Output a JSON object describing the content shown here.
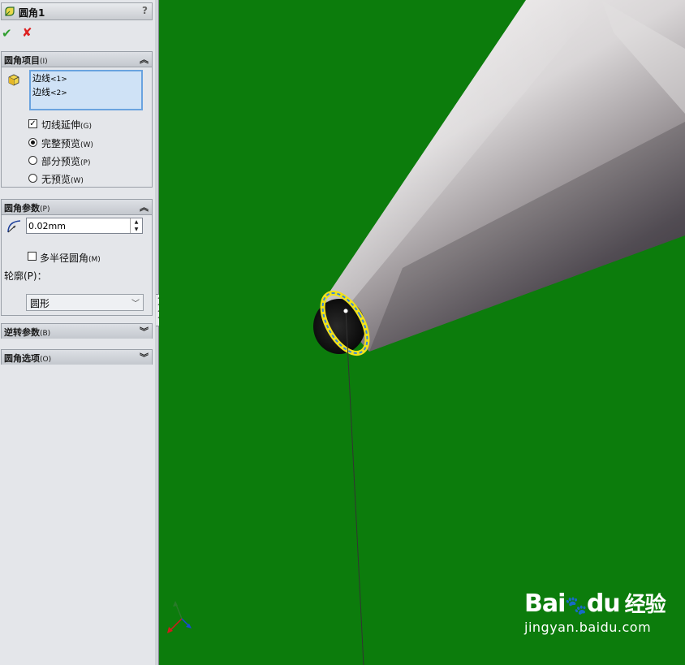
{
  "feature": {
    "title": "圆角1",
    "help": "?"
  },
  "actions": {
    "ok": "✔",
    "cancel": "✘"
  },
  "items_section": {
    "title": "圆角项目",
    "shortcut": "(I)",
    "edges": [
      {
        "name": "边线",
        "suffix": "<1>"
      },
      {
        "name": "边线",
        "suffix": "<2>"
      }
    ],
    "tangent": {
      "label": "切线延伸",
      "shortcut": "(G)",
      "checked": true
    },
    "preview_options": [
      {
        "label": "完整预览",
        "shortcut": "(W)",
        "selected": true
      },
      {
        "label": "部分预览",
        "shortcut": "(P)",
        "selected": false
      },
      {
        "label": "无预览",
        "shortcut": "(W)",
        "selected": false
      }
    ]
  },
  "params_section": {
    "title": "圆角参数",
    "shortcut": "(P)",
    "radius": "0.02mm",
    "multi_radius": {
      "label": "多半径圆角",
      "shortcut": "(M)",
      "checked": false
    },
    "profile_label": "轮廓(P)：",
    "profile_value": "圆形"
  },
  "setback_section": {
    "title": "逆转参数",
    "shortcut": "(B)"
  },
  "options_section": {
    "title": "圆角选项",
    "shortcut": "(O)"
  },
  "watermark": {
    "brand_a": "Bai",
    "brand_b": "du",
    "brand_c": "经验",
    "url": "jingyan.baidu.com"
  },
  "colors": {
    "viewport_bg": "#0c7c0c",
    "panel_bg": "#e4e6ea",
    "edge_highlight": "#f2e21a",
    "selection_blue": "#6aa3df"
  }
}
